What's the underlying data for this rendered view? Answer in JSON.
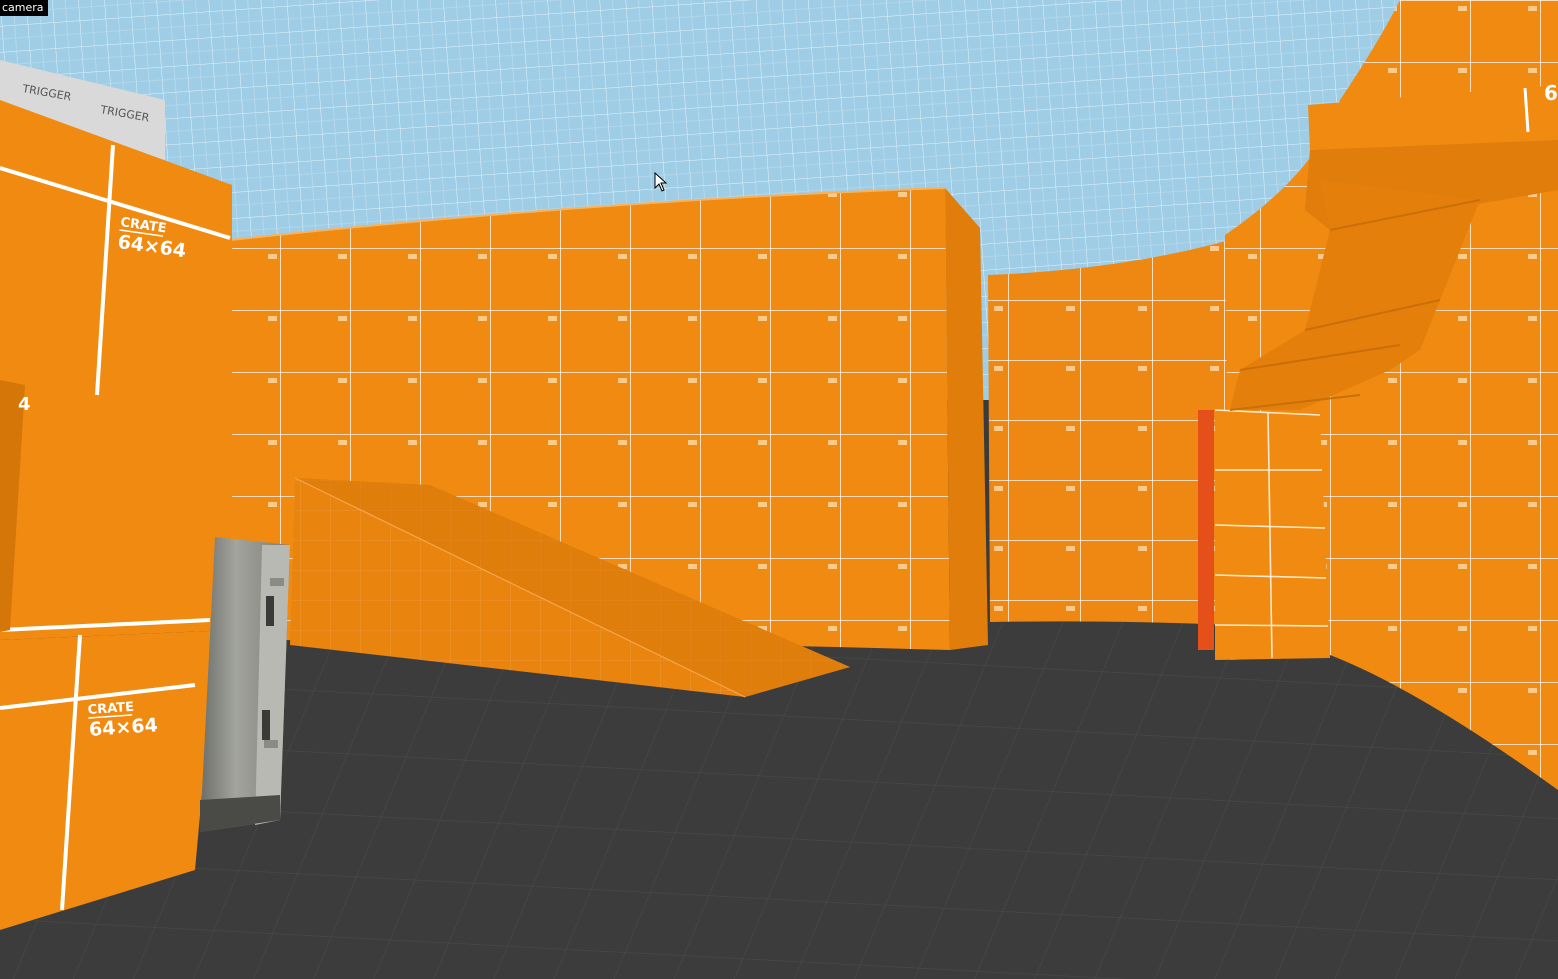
{
  "viewport": {
    "label": "camera",
    "trigger_textures": [
      "TRIGGER",
      "TRIGGER"
    ],
    "crate_textures": [
      {
        "top": "CRATE",
        "bottom": "64×64"
      },
      {
        "top": "CRATE",
        "bottom": "64×64"
      }
    ],
    "partial_texture_labels": [
      "4",
      "6"
    ]
  },
  "colors": {
    "wall": "#f08a10",
    "wall_dark": "#d97a08",
    "floor": "#3d3d3d",
    "sky": "#9fcde6",
    "grid_line": "#ffffff",
    "door": "#8c8d87",
    "door_red": "#e5501a"
  }
}
